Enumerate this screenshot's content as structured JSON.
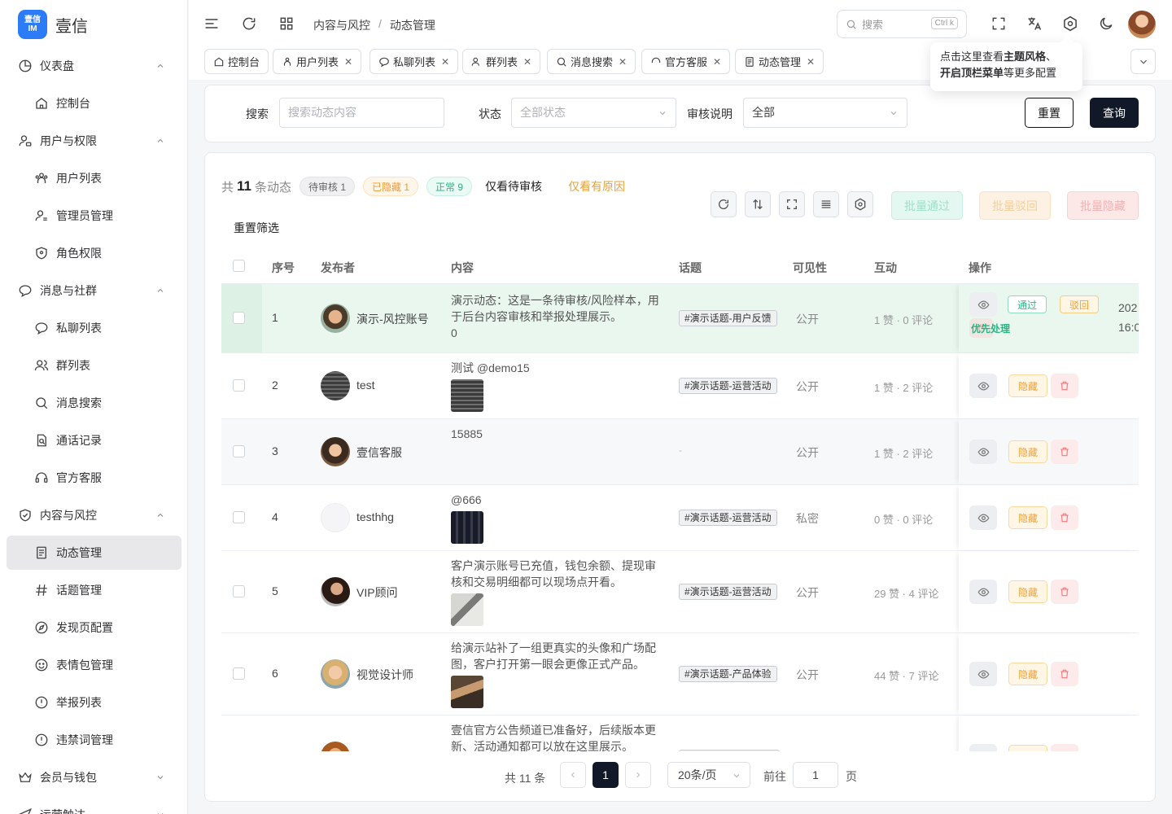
{
  "brand": {
    "logo_top": "壹信",
    "logo_bottom": "IM",
    "name": "壹信"
  },
  "sidebar": {
    "groups": [
      {
        "label": "仪表盘",
        "items": [
          {
            "label": "控制台"
          }
        ]
      },
      {
        "label": "用户与权限",
        "items": [
          {
            "label": "用户列表"
          },
          {
            "label": "管理员管理"
          },
          {
            "label": "角色权限"
          }
        ]
      },
      {
        "label": "消息与社群",
        "items": [
          {
            "label": "私聊列表"
          },
          {
            "label": "群列表"
          },
          {
            "label": "消息搜索"
          },
          {
            "label": "通话记录"
          },
          {
            "label": "官方客服"
          }
        ]
      },
      {
        "label": "内容与风控",
        "items": [
          {
            "label": "动态管理"
          },
          {
            "label": "话题管理"
          },
          {
            "label": "发现页配置"
          },
          {
            "label": "表情包管理"
          },
          {
            "label": "举报列表"
          },
          {
            "label": "违禁词管理"
          }
        ]
      },
      {
        "label": "会员与钱包",
        "items": []
      },
      {
        "label": "运营触达",
        "items": []
      }
    ]
  },
  "header": {
    "breadcrumb": [
      "内容与风控",
      "/",
      "动态管理"
    ],
    "search_placeholder": "搜索",
    "search_kbd": "Ctrl k"
  },
  "tabs": [
    "控制台",
    "用户列表",
    "私聊列表",
    "群列表",
    "消息搜索",
    "官方客服",
    "动态管理"
  ],
  "tooltip": {
    "line1_pre": "点击这里查看",
    "line1_bold": "主题风格",
    "line1_post": "、",
    "line2_bold": "开启顶栏菜单",
    "line2_post": "等更多配置"
  },
  "filter": {
    "search_label": "搜索",
    "search_placeholder": "搜索动态内容",
    "status_label": "状态",
    "status_value": "全部状态",
    "audit_label": "审核说明",
    "audit_value": "全部",
    "reset": "重置",
    "query": "查询"
  },
  "summary": {
    "prefix": "共",
    "count": "11",
    "suffix": "条动态",
    "chip_pending": "待审核 1",
    "chip_hidden": "已隐藏 1",
    "chip_normal": "正常 9",
    "only_pending": "仅看待审核",
    "only_reason": "仅看有原因",
    "reset_filter": "重置筛选"
  },
  "batch": {
    "approve": "批量通过",
    "reject": "批量驳回",
    "hide": "批量隐藏"
  },
  "table": {
    "headers": {
      "index": "序号",
      "publisher": "发布者",
      "content": "内容",
      "topic": "话题",
      "visibility": "可见性",
      "interaction": "互动",
      "action": "操作"
    },
    "rows": [
      {
        "index": "1",
        "publisher": "演示-风控账号",
        "content": "演示动态：这是一条待审核/风险样本，用于后台内容审核和举报处理展示。\n0",
        "topic": "#演示话题-用户反馈",
        "visibility": "公开",
        "interaction": "1 赞 · 0 评论",
        "pass": "通过",
        "reject": "驳回",
        "priority": "优先处理",
        "time_a": "202",
        "time_b": "16:0"
      },
      {
        "index": "2",
        "publisher": "test",
        "content": "测试 @demo15",
        "topic": "#演示话题-运营活动",
        "visibility": "公开",
        "interaction": "1 赞 · 2 评论",
        "hide": "隐藏"
      },
      {
        "index": "3",
        "publisher": "壹信客服",
        "content": "15885",
        "topic": "-",
        "visibility": "公开",
        "interaction": "1 赞 · 2 评论",
        "hide": "隐藏"
      },
      {
        "index": "4",
        "publisher": "testhhg",
        "content": "@666",
        "topic": "#演示话题-运营活动",
        "visibility": "私密",
        "interaction": "0 赞 · 0 评论",
        "hide": "隐藏"
      },
      {
        "index": "5",
        "publisher": "VIP顾问",
        "content": "客户演示账号已充值，钱包余额、提现审核和交易明细都可以现场点开看。",
        "topic": "#演示话题-运营活动",
        "visibility": "公开",
        "interaction": "29 赞 · 4 评论",
        "hide": "隐藏"
      },
      {
        "index": "6",
        "publisher": "视觉设计师",
        "content": "给演示站补了一组更真实的头像和广场配图，客户打开第一眼会更像正式产品。",
        "topic": "#演示话题-产品体验",
        "visibility": "公开",
        "interaction": "44 赞 · 7 评论",
        "hide": "隐藏"
      },
      {
        "index": "7",
        "publisher": "",
        "content": "壹信官方公告频道已准备好，后续版本更新、活动通知都可以放在这里展示。",
        "topic": "",
        "visibility": "",
        "interaction": ""
      }
    ]
  },
  "pager": {
    "total": "共 11 条",
    "current": "1",
    "size": "20条/页",
    "goto": "前往",
    "goto_value": "1",
    "page": "页"
  }
}
